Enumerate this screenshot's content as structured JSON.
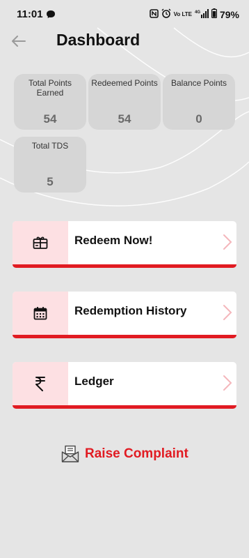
{
  "status": {
    "time": "11:01",
    "network": "Vo LTE",
    "signal": "4G",
    "battery": "79%"
  },
  "header": {
    "title": "Dashboard"
  },
  "stats": [
    {
      "label": "Total Points Earned",
      "value": "54"
    },
    {
      "label": "Redeemed Points",
      "value": "54"
    },
    {
      "label": "Balance Points",
      "value": "0"
    },
    {
      "label": "Total TDS",
      "value": "5"
    }
  ],
  "menu": [
    {
      "label": "Redeem Now!",
      "icon": "gift-card-icon"
    },
    {
      "label": "Redemption History",
      "icon": "calendar-icon"
    },
    {
      "label": "Ledger",
      "icon": "rupee-icon"
    }
  ],
  "complaint": {
    "label": "Raise Complaint",
    "icon": "envelope-icon"
  },
  "colors": {
    "accent": "#e11b22",
    "icon_bg": "#fde0e3",
    "card_bg": "#d6d6d6",
    "page_bg": "#e5e5e5"
  }
}
